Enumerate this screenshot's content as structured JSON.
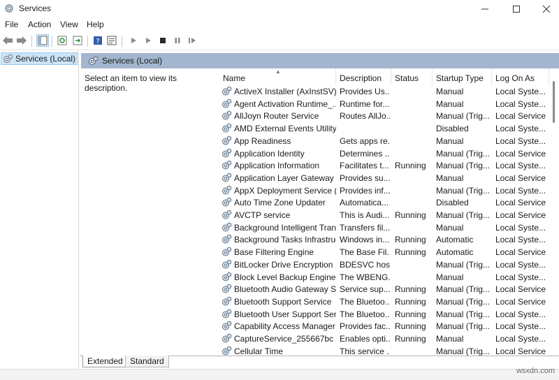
{
  "window": {
    "title": "Services",
    "icon": "gears-icon"
  },
  "menu": [
    "File",
    "Action",
    "View",
    "Help"
  ],
  "tree": {
    "label": "Services (Local)"
  },
  "pane": {
    "header": "Services (Local)",
    "description": "Select an item to view its description."
  },
  "columns": [
    "Name",
    "Description",
    "Status",
    "Startup Type",
    "Log On As"
  ],
  "rows": [
    [
      "ActiveX Installer (AxInstSV)",
      "Provides Us...",
      "",
      "Manual",
      "Local Syste..."
    ],
    [
      "Agent Activation Runtime_...",
      "Runtime for...",
      "",
      "Manual",
      "Local Syste..."
    ],
    [
      "AllJoyn Router Service",
      "Routes AllJo...",
      "",
      "Manual (Trig...",
      "Local Service"
    ],
    [
      "AMD External Events Utility",
      "",
      "",
      "Disabled",
      "Local Syste..."
    ],
    [
      "App Readiness",
      "Gets apps re...",
      "",
      "Manual",
      "Local Syste..."
    ],
    [
      "Application Identity",
      "Determines ...",
      "",
      "Manual (Trig...",
      "Local Service"
    ],
    [
      "Application Information",
      "Facilitates t...",
      "Running",
      "Manual (Trig...",
      "Local Syste..."
    ],
    [
      "Application Layer Gateway ...",
      "Provides su...",
      "",
      "Manual",
      "Local Service"
    ],
    [
      "AppX Deployment Service (...",
      "Provides inf...",
      "",
      "Manual (Trig...",
      "Local Syste..."
    ],
    [
      "Auto Time Zone Updater",
      "Automatica...",
      "",
      "Disabled",
      "Local Service"
    ],
    [
      "AVCTP service",
      "This is Audi...",
      "Running",
      "Manual (Trig...",
      "Local Service"
    ],
    [
      "Background Intelligent Tran...",
      "Transfers fil...",
      "",
      "Manual",
      "Local Syste..."
    ],
    [
      "Background Tasks Infrastruc...",
      "Windows in...",
      "Running",
      "Automatic",
      "Local Syste..."
    ],
    [
      "Base Filtering Engine",
      "The Base Fil...",
      "Running",
      "Automatic",
      "Local Service"
    ],
    [
      "BitLocker Drive Encryption ...",
      "BDESVC hos...",
      "",
      "Manual (Trig...",
      "Local Syste..."
    ],
    [
      "Block Level Backup Engine ...",
      "The WBENG...",
      "",
      "Manual",
      "Local Syste..."
    ],
    [
      "Bluetooth Audio Gateway S...",
      "Service sup...",
      "Running",
      "Manual (Trig...",
      "Local Service"
    ],
    [
      "Bluetooth Support Service",
      "The Bluetoo...",
      "Running",
      "Manual (Trig...",
      "Local Service"
    ],
    [
      "Bluetooth User Support Ser...",
      "The Bluetoo...",
      "Running",
      "Manual (Trig...",
      "Local Syste..."
    ],
    [
      "Capability Access Manager ...",
      "Provides fac...",
      "Running",
      "Manual (Trig...",
      "Local Syste..."
    ],
    [
      "CaptureService_255667bc",
      "Enables opti...",
      "Running",
      "Manual",
      "Local Syste..."
    ],
    [
      "Cellular Time",
      "This service ...",
      "",
      "Manual (Trig...",
      "Local Service"
    ]
  ],
  "tabs": [
    "Extended",
    "Standard"
  ],
  "watermark": "wsxdn.com",
  "colors": {
    "pane_header": "#a2b7cf",
    "tree_selected": "#cce4f7"
  }
}
